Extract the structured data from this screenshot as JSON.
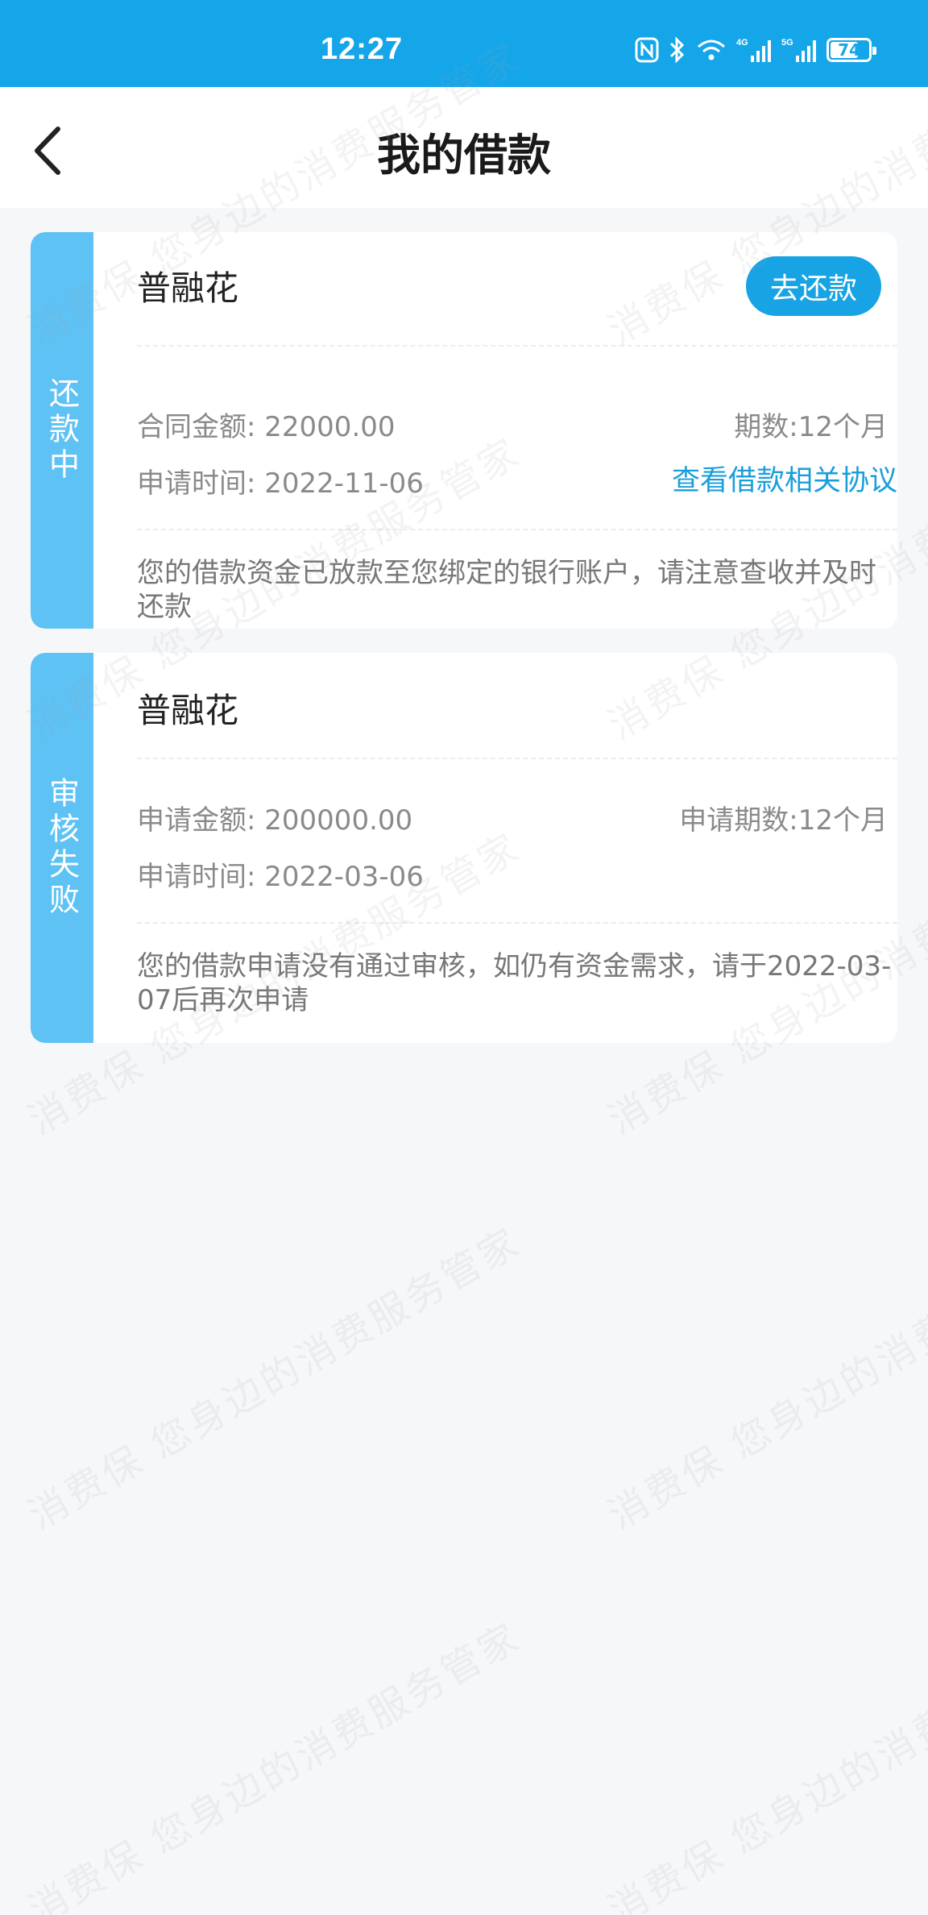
{
  "status_bar": {
    "time": "12:27",
    "network_labels": [
      "4G",
      "5G"
    ],
    "battery_level": "74",
    "battery_fraction": 0.74
  },
  "nav": {
    "title": "我的借款",
    "back_icon": "chevron-left-icon"
  },
  "colors": {
    "status_bar": "#15a6ea",
    "tab": "#5ec2f5",
    "accent": "#18a4e4",
    "link": "#1a9edb"
  },
  "loans": [
    {
      "status": "还款中",
      "product": "普融花",
      "action": "去还款",
      "left_label": "合同金额:",
      "left_value": "22000.00",
      "right_label": "期数:",
      "right_value": "12个月",
      "time_label": "申请时间:",
      "time_value": "2022-11-06",
      "link": "查看借款相关协议",
      "note": "您的借款资金已放款至您绑定的银行账户，请注意查收并及时还款"
    },
    {
      "status": "审核失败",
      "product": "普融花",
      "left_label": "申请金额:",
      "left_value": "200000.00",
      "right_label": "申请期数:",
      "right_value": "12个月",
      "time_label": "申请时间:",
      "time_value": "2022-03-06",
      "note": "您的借款申请没有通过审核，如仍有资金需求，请于2022-03-07后再次申请"
    }
  ],
  "watermark": {
    "line1": "消费保 您身边的消费服务管家"
  }
}
